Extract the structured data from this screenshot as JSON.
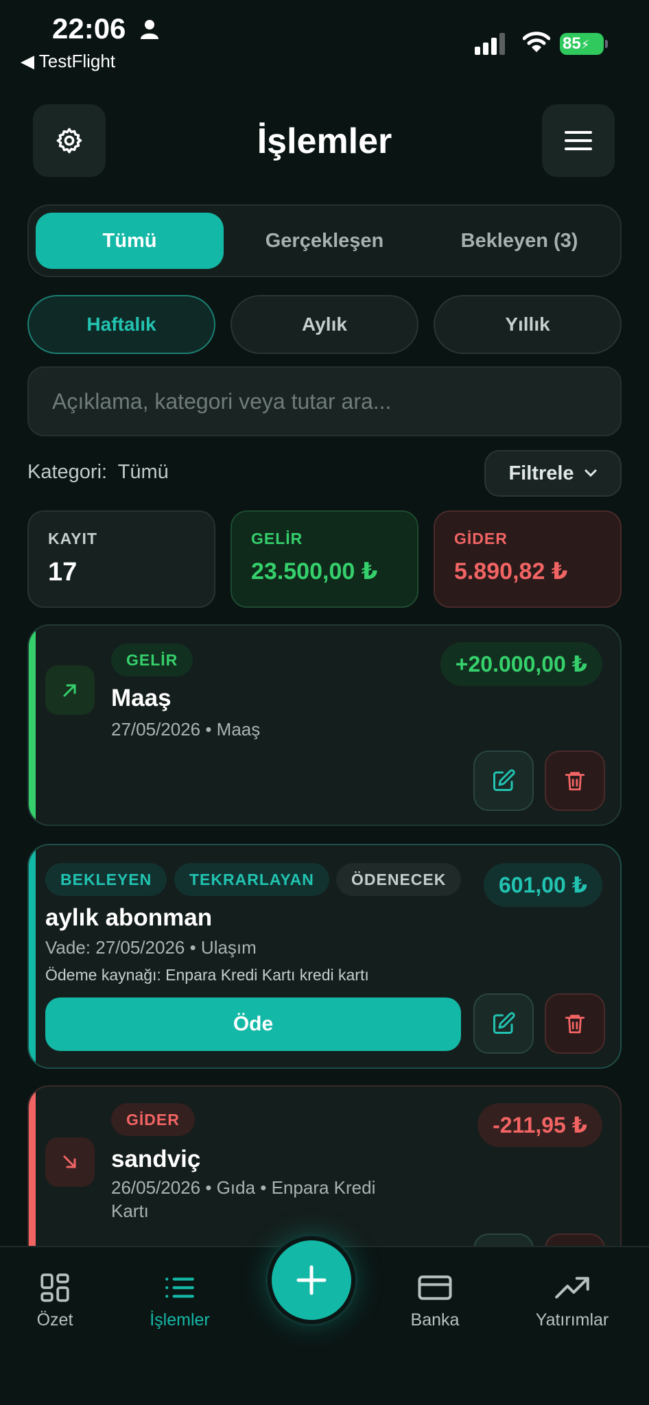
{
  "status_bar": {
    "time": "22:06",
    "back_app": "TestFlight",
    "battery": "85"
  },
  "header": {
    "title": "İşlemler",
    "settings_icon": "gear-icon",
    "menu_icon": "hamburger-menu-icon"
  },
  "segments": [
    {
      "label": "Tümü",
      "active": true
    },
    {
      "label": "Gerçekleşen",
      "active": false
    },
    {
      "label": "Bekleyen (3)",
      "active": false
    }
  ],
  "periods": [
    {
      "label": "Haftalık",
      "active": true
    },
    {
      "label": "Aylık",
      "active": false
    },
    {
      "label": "Yıllık",
      "active": false
    }
  ],
  "search": {
    "placeholder": "Açıklama, kategori veya tutar ara..."
  },
  "category": {
    "label": "Kategori:",
    "value": "Tümü"
  },
  "filter": {
    "label": "Filtrele"
  },
  "stats": {
    "count_label": "KAYIT",
    "count_value": "17",
    "income_label": "GELİR",
    "income_value": "23.500,00 ₺",
    "expense_label": "GİDER",
    "expense_value": "5.890,82 ₺"
  },
  "transactions": [
    {
      "badge": "GELİR",
      "name": "Maaş",
      "meta": "27/05/2026 • Maaş",
      "amount": "+20.000,00 ₺",
      "color": "#35d06c"
    },
    {
      "badges": [
        "BEKLEYEN",
        "TEKRARLAYAN",
        "ÖDENECEK"
      ],
      "name": "aylık abonman",
      "meta": "Vade: 27/05/2026 • Ulaşım",
      "source": "Ödeme kaynağı: Enpara Kredi Kartı kredi kartı",
      "amount": "601,00 ₺",
      "pay_label": "Öde",
      "color": "#14b8a6"
    },
    {
      "badge": "GİDER",
      "name": "sandviç",
      "meta_line1": "26/05/2026 • Gıda • Enpara Kredi",
      "meta_line2": "Kartı",
      "amount": "-211,95 ₺",
      "color": "#f26464"
    }
  ],
  "nav": [
    {
      "label": "Özet",
      "icon": "dashboard-icon",
      "active": false
    },
    {
      "label": "İşlemler",
      "icon": "list-icon",
      "active": true
    },
    {
      "label": "Banka",
      "icon": "credit-card-icon",
      "active": false
    },
    {
      "label": "Yatırımlar",
      "icon": "trending-up-icon",
      "active": false
    }
  ],
  "fab_icon": "plus-icon"
}
